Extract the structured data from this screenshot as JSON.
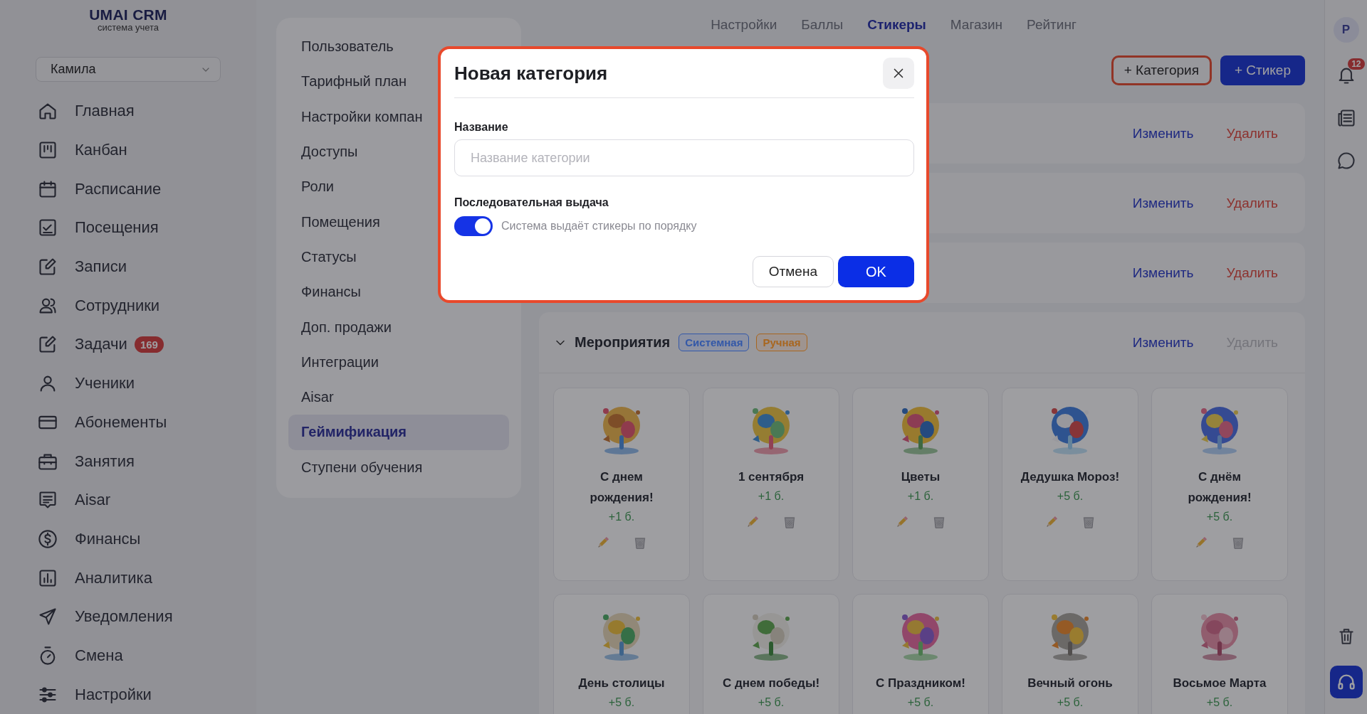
{
  "sidebar": {
    "logo_title": "UMAI CRM",
    "logo_subtitle": "система учета",
    "user_select": "Камила",
    "items": [
      {
        "label": "Главная",
        "selected": false
      },
      {
        "label": "Канбан",
        "selected": false
      },
      {
        "label": "Расписание",
        "selected": false
      },
      {
        "label": "Посещения",
        "selected": false
      },
      {
        "label": "Записи",
        "selected": false
      },
      {
        "label": "Сотрудники",
        "selected": false
      },
      {
        "label": "Задачи",
        "selected": false,
        "badge": "169"
      },
      {
        "label": "Ученики",
        "selected": false
      },
      {
        "label": "Абонементы",
        "selected": false
      },
      {
        "label": "Занятия",
        "selected": false
      },
      {
        "label": "Aisar",
        "selected": false
      },
      {
        "label": "Финансы",
        "selected": false
      },
      {
        "label": "Аналитика",
        "selected": false
      },
      {
        "label": "Уведомления",
        "selected": false
      },
      {
        "label": "Смена",
        "selected": false
      },
      {
        "label": "Настройки",
        "selected": false
      }
    ]
  },
  "settings_menu": [
    {
      "label": "Пользователь",
      "selected": false
    },
    {
      "label": "Тарифный план",
      "selected": false
    },
    {
      "label": "Настройки компан",
      "selected": false
    },
    {
      "label": "Доступы",
      "selected": false
    },
    {
      "label": "Роли",
      "selected": false
    },
    {
      "label": "Помещения",
      "selected": false
    },
    {
      "label": "Статусы",
      "selected": false
    },
    {
      "label": "Финансы",
      "selected": false
    },
    {
      "label": "Доп. продажи",
      "selected": false
    },
    {
      "label": "Интеграции",
      "selected": false
    },
    {
      "label": "Aisar",
      "selected": false
    },
    {
      "label": "Геймификация",
      "selected": true
    },
    {
      "label": "Ступени обучения",
      "selected": false
    }
  ],
  "tabs": [
    {
      "label": "Настройки",
      "selected": false
    },
    {
      "label": "Баллы",
      "selected": false
    },
    {
      "label": "Стикеры",
      "selected": true
    },
    {
      "label": "Магазин",
      "selected": false
    },
    {
      "label": "Рейтинг",
      "selected": false
    }
  ],
  "toolbar": {
    "add_category": "+ Категория",
    "add_sticker": "+ Стикер"
  },
  "categories": [
    {
      "edit": "Изменить",
      "delete": "Удалить",
      "delete_disabled": false
    },
    {
      "edit": "Изменить",
      "delete": "Удалить",
      "delete_disabled": false
    },
    {
      "edit": "Изменить",
      "delete": "Удалить",
      "delete_disabled": false
    },
    {
      "name": "Мероприятия",
      "expanded": true,
      "tags": [
        {
          "label": "Системная",
          "color": "#3358a8"
        },
        {
          "label": "Ручная",
          "color": "#a8661f"
        }
      ],
      "edit": "Изменить",
      "delete": "Удалить",
      "delete_disabled": true,
      "stickers": [
        {
          "name": "С днем рождения!",
          "points": "+1 б."
        },
        {
          "name": "1 сентября",
          "points": "+1 б."
        },
        {
          "name": "Цветы",
          "points": "+1 б."
        },
        {
          "name": "Дедушка Мороз!",
          "points": "+5 б."
        },
        {
          "name": "С днём рождения!",
          "points": "+5 б."
        },
        {
          "name": "День столицы",
          "points": "+5 б."
        },
        {
          "name": "С днем победы!",
          "points": "+5 б."
        },
        {
          "name": "С Праздником!",
          "points": "+5 б."
        },
        {
          "name": "Вечный огонь",
          "points": "+5 б."
        },
        {
          "name": "Восьмое Марта",
          "points": "+5 б."
        }
      ]
    }
  ],
  "rail": {
    "avatar": "Р",
    "notifications_badge": "12"
  },
  "modal": {
    "title": "Новая категория",
    "name_label": "Название",
    "name_placeholder": "Название категории",
    "toggle": {
      "label": "Последовательная выдача",
      "on": true,
      "description": "Система выдаёт стикеры по порядку"
    },
    "cancel": "Отмена",
    "ok": "OK"
  }
}
